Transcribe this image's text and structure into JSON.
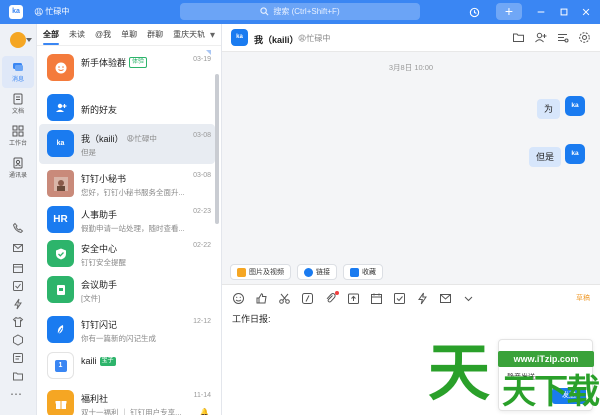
{
  "topbar": {
    "app_logo": "ka",
    "status_text": "忙碌中",
    "search_placeholder": "搜索 (Ctrl+Shift+F)",
    "history_icon": "history-icon",
    "add_label": "+",
    "window_controls": [
      "minimize-icon",
      "maximize-icon",
      "close-icon"
    ],
    "bar_color": "#3a86f3"
  },
  "rail": {
    "items": [
      {
        "label": "消息",
        "icon": "message-icon",
        "active": true
      },
      {
        "label": "文档",
        "icon": "document-icon",
        "active": false
      },
      {
        "label": "工作台",
        "icon": "workbench-icon",
        "active": false
      },
      {
        "label": "通讯录",
        "icon": "contacts-icon",
        "active": false
      }
    ],
    "bottom_icons": [
      "phone-icon",
      "mail-icon",
      "calendar-icon",
      "todo-icon",
      "ding-icon",
      "shirt-icon",
      "cube-icon",
      "note-icon",
      "folder-icon"
    ],
    "more": "⋯"
  },
  "conv_list": {
    "tabs": [
      "全部",
      "未读",
      "@我",
      "单聊",
      "群聊",
      "重庆天轨"
    ],
    "items": [
      {
        "name": "新手体验群",
        "tag": "体验",
        "tag_color": "green",
        "sub": "",
        "date": "03-19",
        "color": "#f47b3c",
        "initial": "☺"
      },
      {
        "name": "新的好友",
        "tag": "",
        "sub": "",
        "date": "",
        "color": "#1a7bf0",
        "initial": "+"
      },
      {
        "name": "我（kaili）",
        "tag": "",
        "status": "😩忙碌中",
        "sub": "但是",
        "date": "03-08",
        "color": "#1a7bf0",
        "initial": "ka",
        "selected": true
      },
      {
        "name": "钉钉小秘书",
        "tag": "",
        "sub": "您好，钉钉小秘书服务全面升...",
        "date": "03-08",
        "color": "#c98a7a",
        "initial": "秘"
      },
      {
        "name": "人事助手",
        "tag": "",
        "sub": "假勤申请一站处理，随时查看...",
        "date": "02-23",
        "color": "#1a7bf0",
        "initial": "HR"
      },
      {
        "name": "安全中心",
        "tag": "",
        "sub": "钉钉安全提醒",
        "date": "02-22",
        "color": "#2db46b",
        "initial": "✓"
      },
      {
        "name": "会议助手",
        "tag": "",
        "sub": "[文件]",
        "date": "",
        "color": "#2db46b",
        "initial": "会"
      },
      {
        "name": "钉钉闪记",
        "tag": "",
        "sub": "你有一篇新的闪记生成",
        "date": "12-12",
        "color": "#1a7bf0",
        "initial": "闪"
      },
      {
        "name": "kaili",
        "tag": "宝子",
        "tag_color": "blue",
        "sub": "",
        "date": "",
        "color": "#ffffff",
        "initial": "1"
      },
      {
        "name": "福利社",
        "tag": "",
        "sub": "双十一福利 ｜ 钉钉用户专享...",
        "date": "11-14",
        "color": "#f5a623",
        "initial": "福"
      }
    ]
  },
  "chat": {
    "avatar": "ka",
    "title": "我（kaili）",
    "status": "😩忙碌中",
    "header_icons": [
      "folder-icon",
      "add-member-icon",
      "list-icon",
      "settings-icon"
    ],
    "timestamp": "3月8日 10:00",
    "messages": [
      {
        "text": "为",
        "avatar": "ka"
      },
      {
        "text": "但是",
        "avatar": "ka"
      }
    ],
    "quick_actions": [
      {
        "label": "图片及视频",
        "color": "#f5a623"
      },
      {
        "label": "链接",
        "color": "#1a7bf0"
      },
      {
        "label": "收藏",
        "color": "#1a7bf0"
      }
    ],
    "tools": [
      "emoji-icon",
      "thumbs-up-icon",
      "scissors-icon",
      "slash-icon",
      "clip-icon",
      "upload-icon",
      "calendar-icon",
      "check-icon",
      "ding-icon",
      "mail-icon",
      "chevron-down-icon"
    ],
    "draft_label": "草稿",
    "draft_text": "工作日报:",
    "send_option": "静音发送",
    "send_label": "发送"
  },
  "watermark": {
    "url": "www.iTzip.com",
    "big": "天",
    "small": "天下载"
  }
}
